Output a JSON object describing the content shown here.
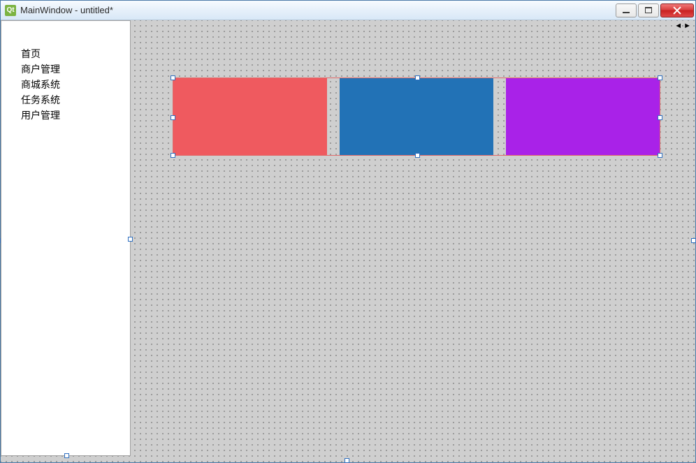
{
  "window": {
    "title": "MainWindow - untitled*",
    "icon_label": "Qt"
  },
  "sidebar": {
    "items": [
      {
        "label": "首页"
      },
      {
        "label": "商户管理"
      },
      {
        "label": "商城系统"
      },
      {
        "label": "任务系统"
      },
      {
        "label": "用户管理"
      }
    ]
  },
  "layout": {
    "boxes": [
      {
        "color": "#ef5a5f",
        "name": "red-box"
      },
      {
        "color": "#2272b6",
        "name": "blue-box"
      },
      {
        "color": "#a922e8",
        "name": "purple-box"
      }
    ]
  },
  "nav": {
    "left": "◄",
    "right": "►"
  }
}
